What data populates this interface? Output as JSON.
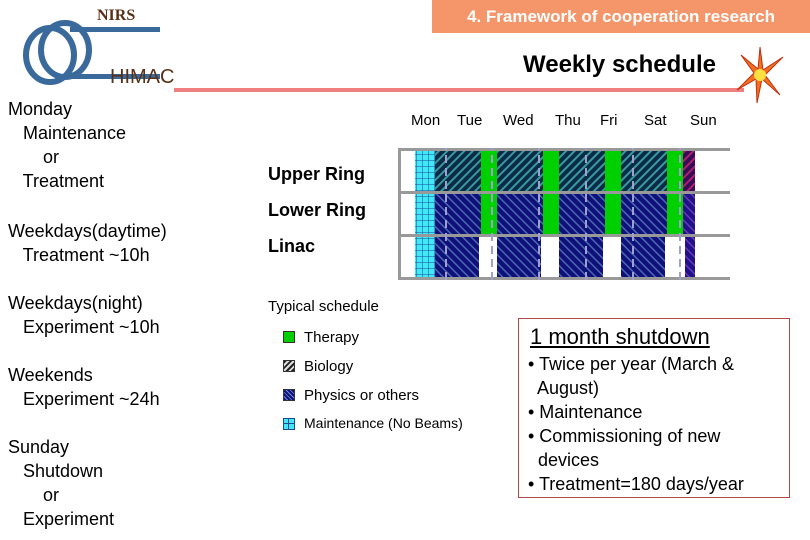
{
  "logo": {
    "top": "NIRS",
    "bottom": "HIMAC"
  },
  "section_title": "4. Framework of cooperation research",
  "page_title": "Weekly schedule",
  "left_notes": [
    {
      "head": "Monday",
      "lines": [
        "Maintenance",
        "    or",
        "Treatment"
      ]
    },
    {
      "head": "Weekdays(daytime)",
      "lines": [
        "Treatment ~10h"
      ]
    },
    {
      "head": "Weekdays(night)",
      "lines": [
        "Experiment ~10h"
      ]
    },
    {
      "head": "Weekends",
      "lines": [
        "Experiment ~24h"
      ]
    },
    {
      "head": "Sunday",
      "lines": [
        "Shutdown",
        "    or",
        "Experiment"
      ]
    }
  ],
  "days": [
    "Mon",
    "Tue",
    "Wed",
    "Thu",
    "Fri",
    "Sat",
    "Sun"
  ],
  "rings": [
    "Upper Ring",
    "Lower Ring",
    "Linac"
  ],
  "legend": {
    "title": "Typical schedule",
    "items": [
      {
        "label": "Therapy",
        "color": "#00d000"
      },
      {
        "label": "Biology",
        "color": "#1a3a5a"
      },
      {
        "label": "Physics or others",
        "color": "#10107a"
      },
      {
        "label": "Maintenance (No Beams)",
        "color": "#40e0f0"
      }
    ]
  },
  "shutdown_box": {
    "title": "1 month shutdown",
    "bullets": [
      "Twice per year (March &\n  August)",
      "Maintenance",
      "Commissioning of new\n  devices",
      "Treatment=180 days/year"
    ]
  }
}
